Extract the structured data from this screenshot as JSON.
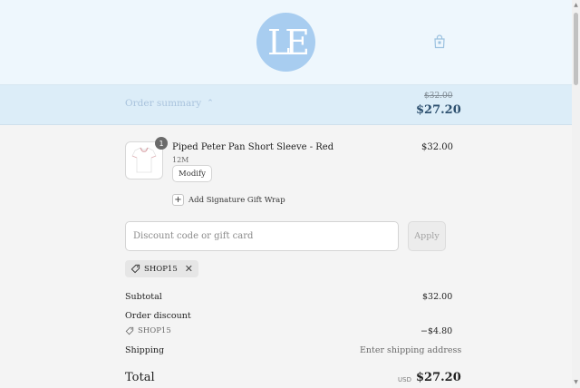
{
  "header": {
    "logo_text": "LE",
    "cart_icon": "shopping-bag-icon"
  },
  "summary": {
    "toggle_label": "Order summary",
    "toggle_icon": "chevron-up-icon",
    "original_price": "$32.00",
    "total_price": "$27.20"
  },
  "item": {
    "quantity": "1",
    "name": "Piped Peter Pan Short Sleeve - Red",
    "variant": "12M",
    "modify_label": "Modify",
    "price": "$32.00"
  },
  "gift_wrap": {
    "icon": "plus-icon",
    "label": "Add Signature Gift Wrap"
  },
  "discount": {
    "placeholder": "Discount code or gift card",
    "apply_label": "Apply",
    "applied_code": "SHOP15"
  },
  "totals": {
    "subtotal_label": "Subtotal",
    "subtotal_value": "$32.00",
    "order_discount_label": "Order discount",
    "discount_code": "SHOP15",
    "discount_value": "−$4.80",
    "shipping_label": "Shipping",
    "shipping_value": "Enter shipping address",
    "total_label": "Total",
    "currency": "USD",
    "total_value": "$27.20"
  },
  "colors": {
    "header_bg": "#eef7fd",
    "summary_bg": "#dcedf8",
    "logo_bg": "#a8cdf0",
    "accent": "#2c4f6e"
  }
}
